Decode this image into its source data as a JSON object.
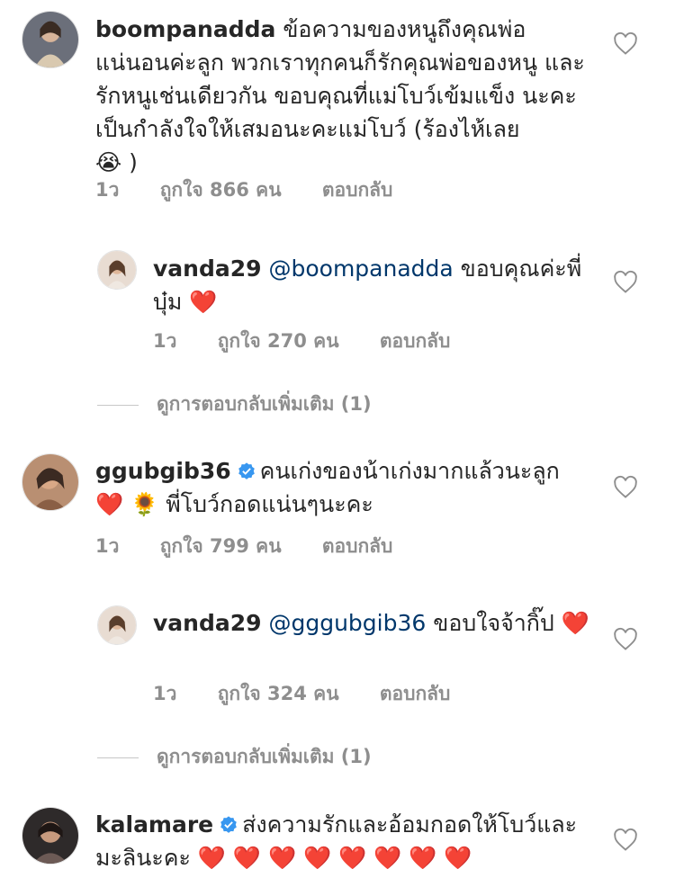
{
  "comments": [
    {
      "username": "boompanadda",
      "verified": false,
      "text": "ข้อความของหนูถึงคุณพ่อ แน่นอนค่ะลูก พวกเราทุกคนก็รักคุณพ่อของหนู และรักหนูเช่นเดียวกัน ขอบคุณที่แม่โบว์เข้มแข็ง นะคะ เป็นกำลังใจให้เสมอนะคะแม่โบว์ (ร้องไห้เลย",
      "text_end": ")",
      "emoji": "😭",
      "time": "1ว",
      "likes": "ถูกใจ 866 คน",
      "reply_label": "ตอบกลับ",
      "replies": [
        {
          "username": "vanda29",
          "mention": "@boompanadda",
          "text": "ขอบคุณค่ะพี่บุ๋ม",
          "emoji": "❤️",
          "time": "1ว",
          "likes": "ถูกใจ 270 คน",
          "reply_label": "ตอบกลับ"
        }
      ],
      "view_more": "ดูการตอบกลับเพิ่มเติม (1)"
    },
    {
      "username": "ggubgib36",
      "verified": true,
      "text": "คนเก่งของน้าเก่งมากแล้วนะลูก",
      "emoji1": "❤️",
      "emoji2": "🌻",
      "text2": "พี่โบว์กอดแน่นๆนะคะ",
      "time": "1ว",
      "likes": "ถูกใจ 799 คน",
      "reply_label": "ตอบกลับ",
      "replies": [
        {
          "username": "vanda29",
          "mention": "@gggubgib36",
          "text": "ขอบใจจ้ากิ๊ป",
          "emoji": "❤️",
          "time": "1ว",
          "likes": "ถูกใจ 324 คน",
          "reply_label": "ตอบกลับ"
        }
      ],
      "view_more": "ดูการตอบกลับเพิ่มเติม (1)"
    },
    {
      "username": "kalamare",
      "verified": true,
      "text": "ส่งความรักและอ้อมกอดให้โบว์และมะลินะคะ",
      "emoji": "❤️ ❤️ ❤️ ❤️ ❤️ ❤️ ❤️ ❤️"
    }
  ]
}
